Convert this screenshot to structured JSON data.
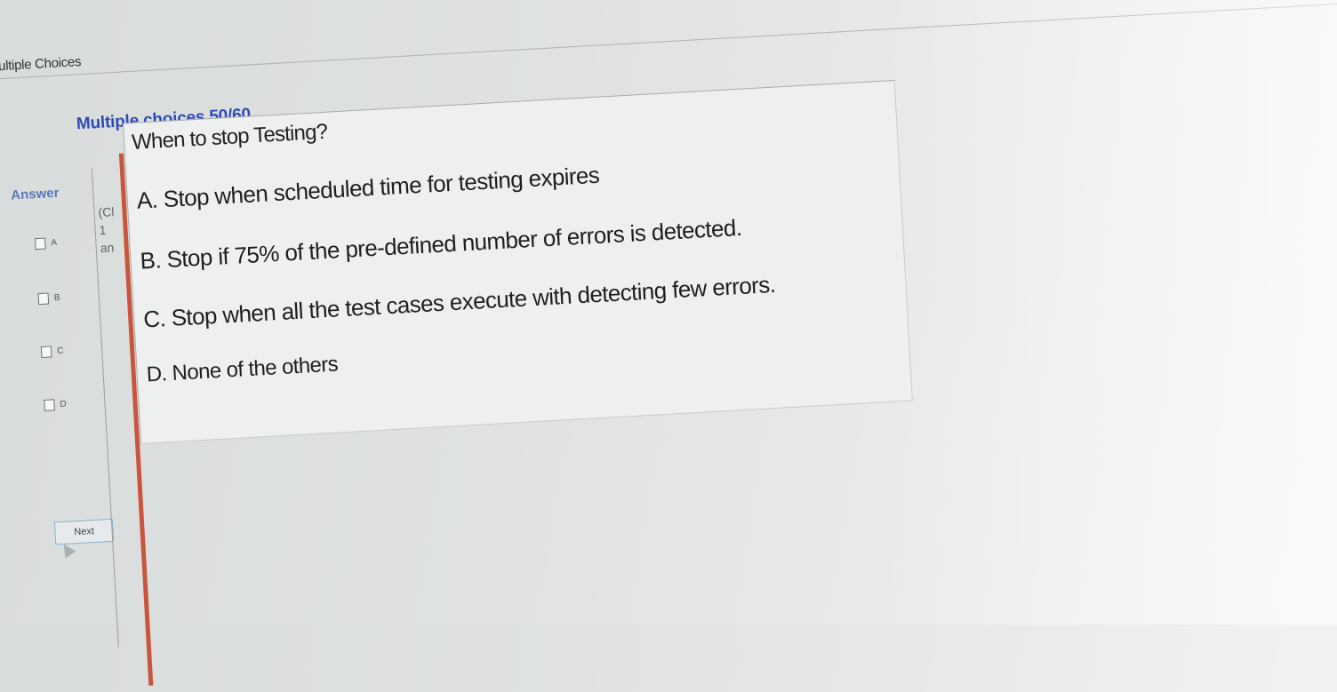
{
  "window": {
    "title": "ultiple Choices"
  },
  "quiz": {
    "heading": "Multiple choices 50/60",
    "answer_label": "Answer",
    "choices": [
      "A",
      "B",
      "C",
      "D"
    ],
    "side_fragments": [
      "(Cl",
      "1",
      "an"
    ],
    "question": "When to stop Testing?",
    "options": [
      "A. Stop when scheduled time for testing expires",
      "B. Stop if 75% of the pre-defined number of errors is detected.",
      "C. Stop when all the test cases execute with detecting few errors.",
      "D. None of the others"
    ],
    "next_label": "Next"
  }
}
